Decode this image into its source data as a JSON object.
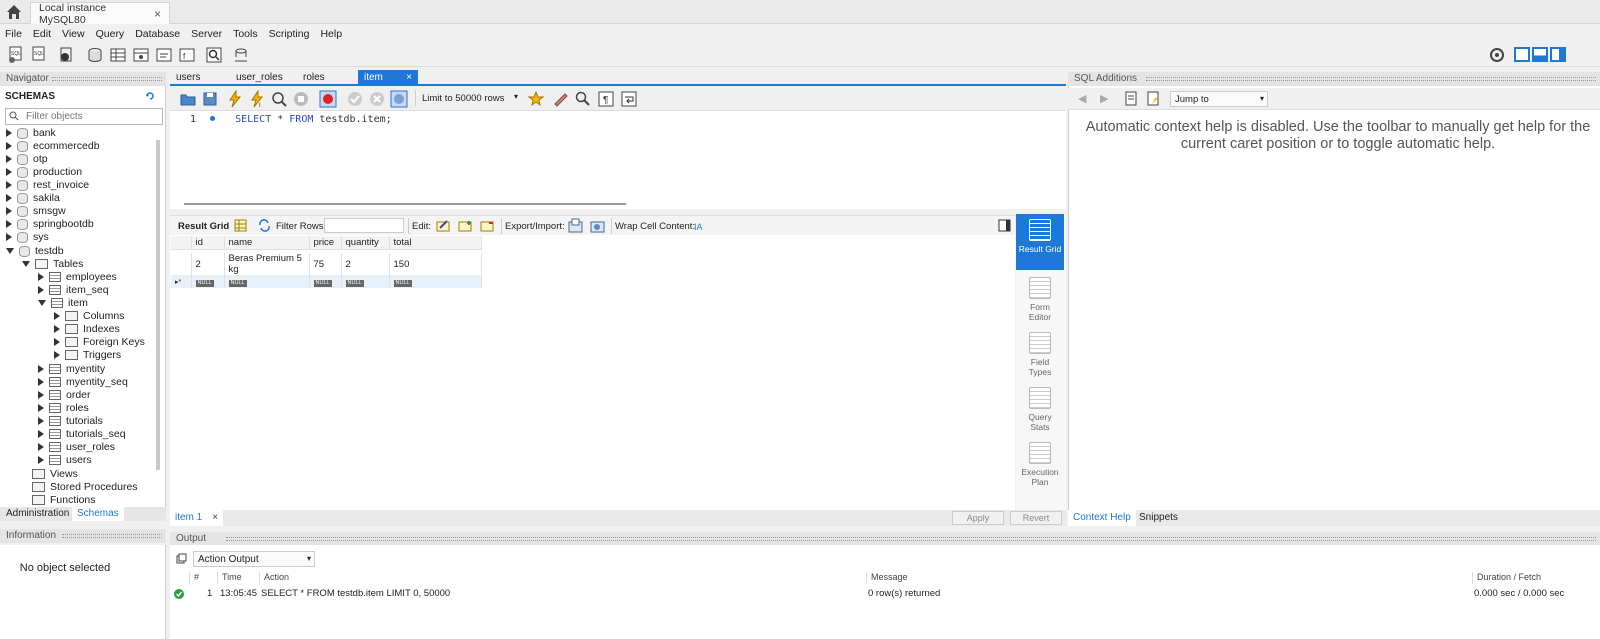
{
  "window": {
    "tab_title": "Local instance MySQL80",
    "tab_close": "×"
  },
  "menu": [
    "File",
    "Edit",
    "View",
    "Query",
    "Database",
    "Server",
    "Tools",
    "Scripting",
    "Help"
  ],
  "navigator": {
    "header": "Navigator",
    "schemas_title": "SCHEMAS",
    "filter_placeholder": "Filter objects",
    "schemas": [
      "bank",
      "ecommercedb",
      "otp",
      "production",
      "rest_invoice",
      "sakila",
      "smsgw",
      "springbootdb",
      "sys",
      "testdb"
    ],
    "testdb_children": {
      "tables": "Tables",
      "views": "Views",
      "procedures": "Stored Procedures",
      "functions": "Functions"
    },
    "tables": [
      "employees",
      "item_seq",
      "item",
      "myentity",
      "myentity_seq",
      "order",
      "roles",
      "tutorials",
      "tutorials_seq",
      "user_roles",
      "users"
    ],
    "item_children": [
      "Columns",
      "Indexes",
      "Foreign Keys",
      "Triggers"
    ],
    "bottom_tabs": [
      "Administration",
      "Schemas"
    ]
  },
  "editor": {
    "tabs": [
      "users",
      "user_roles",
      "roles",
      "item"
    ],
    "active_tab": "item",
    "tab_close": "×",
    "limit_select": "Limit to 50000 rows",
    "line_number": "1",
    "sql": {
      "kw1": "SELECT",
      "star": " * ",
      "kw2": "FROM",
      "rest": " testdb.item;"
    }
  },
  "result": {
    "toolbar": {
      "result_grid": "Result Grid",
      "filter_rows": "Filter Rows:",
      "edit": "Edit:",
      "export_import": "Export/Import:",
      "wrap": "Wrap Cell Content:"
    },
    "columns": [
      "id",
      "name",
      "price",
      "quantity",
      "total"
    ],
    "rows": [
      [
        "2",
        "Beras Premium 5 kg",
        "75",
        "2",
        "150"
      ]
    ],
    "null_label": "NULL",
    "new_row_marker": "▸*",
    "side_buttons": [
      "Result Grid",
      "Form Editor",
      "Field Types",
      "Query Stats",
      "Execution Plan"
    ],
    "result_tab": "item 1",
    "apply": "Apply",
    "revert": "Revert"
  },
  "sql_additions": {
    "header": "SQL Additions",
    "jump_to": "Jump to",
    "help_text": "Automatic context help is disabled. Use the toolbar to manually get help for the current caret position or to toggle automatic help.",
    "tabs": [
      "Context Help",
      "Snippets"
    ]
  },
  "information": {
    "header": "Information",
    "message": "No object selected"
  },
  "output": {
    "header": "Output",
    "select": "Action Output",
    "columns": [
      "#",
      "Time",
      "Action",
      "Message",
      "Duration / Fetch"
    ],
    "rows": [
      {
        "num": "1",
        "time": "13:05:45",
        "action": "SELECT * FROM testdb.item LIMIT 0, 50000",
        "message": "0 row(s) returned",
        "duration": "0.000 sec / 0.000 sec"
      }
    ]
  },
  "colors": {
    "accent": "#1e78d6",
    "ok": "#2a9d3a",
    "keyword": "#2a4fc4"
  }
}
